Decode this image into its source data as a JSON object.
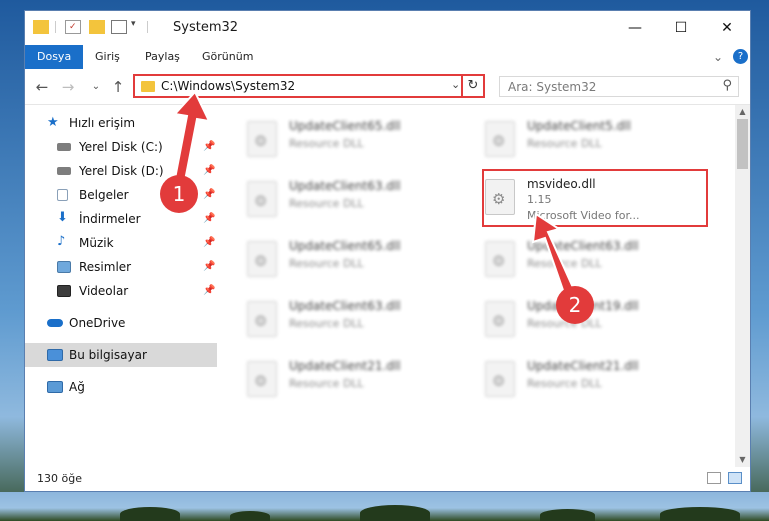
{
  "window": {
    "title": "System32",
    "minimize": "—",
    "maximize": "☐",
    "close": "✕"
  },
  "ribbon": {
    "tabs": [
      "Dosya",
      "Giriş",
      "Paylaş",
      "Görünüm"
    ],
    "expand": "⌄",
    "help": "?"
  },
  "address": {
    "back": "←",
    "forward": "→",
    "recent": "⌄",
    "up": "↑",
    "path": "C:\\Windows\\System32",
    "chevron": "⌄",
    "refresh": "↻",
    "search_placeholder": "Ara: System32",
    "search_icon": "⚲"
  },
  "sidebar": {
    "items": [
      {
        "label": "Hızlı erişim",
        "icon": "star-icon",
        "pinned": false
      },
      {
        "label": "Yerel Disk (C:)",
        "icon": "drive-icon",
        "pinned": true
      },
      {
        "label": "Yerel Disk (D:)",
        "icon": "drive-icon",
        "pinned": true
      },
      {
        "label": "Belgeler",
        "icon": "documents-icon",
        "pinned": true
      },
      {
        "label": "İndirmeler",
        "icon": "download-icon",
        "pinned": true
      },
      {
        "label": "Müzik",
        "icon": "music-icon",
        "pinned": true
      },
      {
        "label": "Resimler",
        "icon": "pictures-icon",
        "pinned": true
      },
      {
        "label": "Videolar",
        "icon": "videos-icon",
        "pinned": true
      },
      {
        "label": "OneDrive",
        "icon": "cloud-icon",
        "pinned": false
      },
      {
        "label": "Bu bilgisayar",
        "icon": "computer-icon",
        "pinned": false,
        "selected": true
      },
      {
        "label": "Ağ",
        "icon": "network-icon",
        "pinned": false
      }
    ],
    "pin_glyph": "📌"
  },
  "files": [
    {
      "name": "UpdateClient65.dll",
      "type": "Resource DLL",
      "blurred": true
    },
    {
      "name": "UpdateClient5.dll",
      "type": "Resource DLL",
      "blurred": true
    },
    {
      "name": "UpdateClient63.dll",
      "type": "Resource DLL",
      "blurred": true
    },
    {
      "name": "msvideo.dll",
      "version": "1.15",
      "type": "Microsoft Video for...",
      "blurred": false,
      "highlighted": true
    },
    {
      "name": "UpdateClient65.dll",
      "type": "Resource DLL",
      "blurred": true
    },
    {
      "name": "UpdateClient63.dll",
      "type": "Resource DLL",
      "blurred": true
    },
    {
      "name": "UpdateClient63.dll",
      "type": "Resource DLL",
      "blurred": true
    },
    {
      "name": "UpdateClient19.dll",
      "type": "Resource DLL",
      "blurred": true
    },
    {
      "name": "UpdateClient21.dll",
      "type": "Resource DLL",
      "blurred": true
    },
    {
      "name": "UpdateClient21.dll",
      "type": "Resource DLL",
      "blurred": true
    }
  ],
  "status": {
    "count": "130 öğe"
  },
  "annotations": {
    "step1": "1",
    "step2": "2",
    "color": "#e23b3b"
  }
}
